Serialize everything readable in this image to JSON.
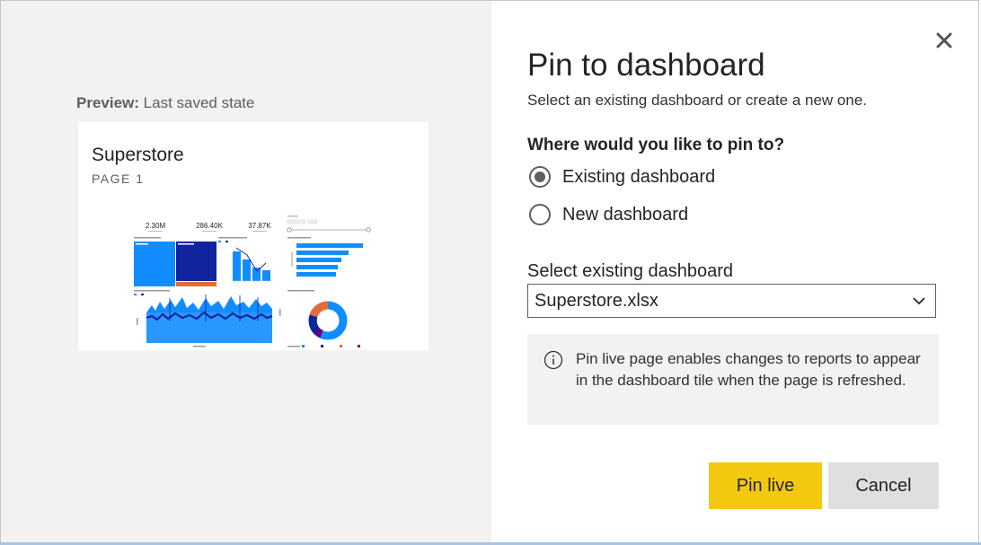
{
  "preview": {
    "label_bold": "Preview:",
    "label_rest": " Last saved state",
    "card": {
      "title": "Superstore",
      "subtitle": "PAGE 1",
      "kpis": [
        "2.30M",
        "286.40K",
        "37.87K"
      ]
    }
  },
  "dialog": {
    "title": "Pin to dashboard",
    "subtitle": "Select an existing dashboard or create a new one.",
    "question": "Where would you like to pin to?",
    "options": [
      {
        "label": "Existing dashboard",
        "selected": true
      },
      {
        "label": "New dashboard",
        "selected": false
      }
    ],
    "select": {
      "label": "Select existing dashboard",
      "value": "Superstore.xlsx"
    },
    "info": {
      "text": "Pin live page enables changes to reports to appear in the dashboard tile when the page is refreshed."
    },
    "buttons": {
      "primary": "Pin live",
      "secondary": "Cancel"
    },
    "icons": {
      "close": "close-icon",
      "chevron": "chevron-down-icon",
      "info": "info-icon"
    }
  },
  "colors": {
    "primary_button": "#f2c811",
    "secondary_button": "#e1dfdd",
    "preview_bg": "#f3f2f1",
    "thumb_blue": "#118dff",
    "thumb_navy": "#12239e",
    "thumb_orange": "#e66c37"
  }
}
